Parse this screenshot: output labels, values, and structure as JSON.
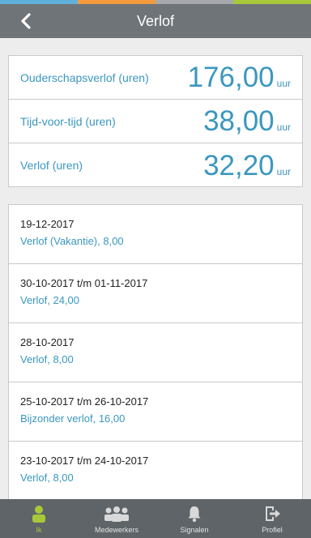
{
  "theme": {
    "stripe": [
      "#5fb1dc",
      "#f39a3c",
      "#a8a9ad",
      "#a8c83a"
    ],
    "header_bg": "#6f7478",
    "accent": "#3a97c0",
    "tab_active": "#a8c83a"
  },
  "header": {
    "back_icon": "chevron-left-icon",
    "title": "Verlof"
  },
  "balances": [
    {
      "label": "Ouderschapsverlof (uren)",
      "value": "176,00",
      "unit": "uur"
    },
    {
      "label": "Tijd-voor-tijd (uren)",
      "value": "38,00",
      "unit": "uur"
    },
    {
      "label": "Verlof (uren)",
      "value": "32,20",
      "unit": "uur"
    }
  ],
  "history": [
    {
      "date": "19-12-2017",
      "type": "Verlof (Vakantie), 8,00"
    },
    {
      "date": "30-10-2017 t/m 01-11-2017",
      "type": "Verlof, 24,00"
    },
    {
      "date": "28-10-2017",
      "type": "Verlof, 8,00"
    },
    {
      "date": "25-10-2017 t/m 26-10-2017",
      "type": "Bijzonder verlof, 16,00"
    },
    {
      "date": "23-10-2017 t/m 24-10-2017",
      "type": "Verlof, 8,00"
    }
  ],
  "tabs": [
    {
      "label": "Ik",
      "icon": "person-icon",
      "active": true
    },
    {
      "label": "Medewerkers",
      "icon": "group-icon",
      "active": false
    },
    {
      "label": "Signalen",
      "icon": "bell-icon",
      "active": false
    },
    {
      "label": "Profiel",
      "icon": "logout-icon",
      "active": false
    }
  ]
}
